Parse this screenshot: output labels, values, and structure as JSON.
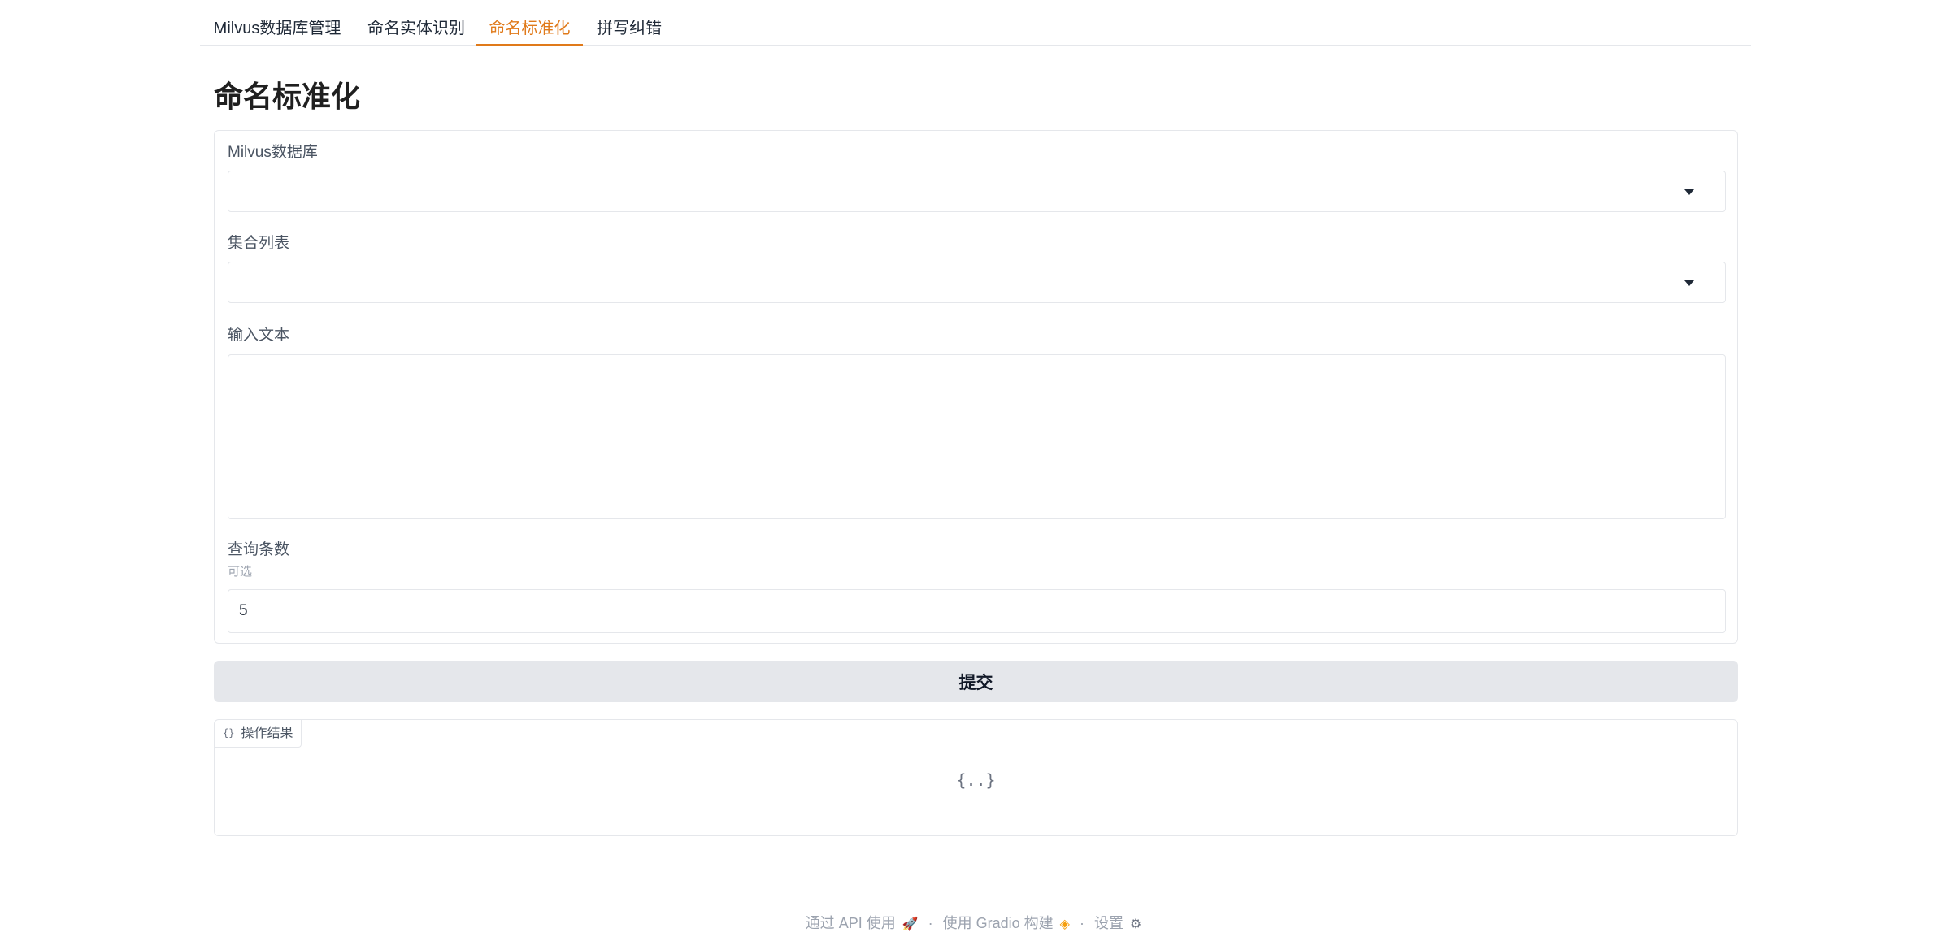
{
  "tabs": [
    {
      "label": "Milvus数据库管理",
      "active": false
    },
    {
      "label": "命名实体识别",
      "active": false
    },
    {
      "label": "命名标准化",
      "active": true
    },
    {
      "label": "拼写纠错",
      "active": false
    }
  ],
  "page_title": "命名标准化",
  "form": {
    "database_label": "Milvus数据库",
    "database_value": "",
    "collection_label": "集合列表",
    "collection_value": "",
    "input_label": "输入文本",
    "input_value": "",
    "count_label": "查询条数",
    "count_info": "可选",
    "count_value": "5"
  },
  "submit_label": "提交",
  "result": {
    "label": "操作结果",
    "icon": "{}",
    "placeholder": "{..}"
  },
  "footer": {
    "api_label": "通过 API 使用",
    "api_icon": "rocket-icon",
    "built_label": "使用 Gradio 构建",
    "built_icon": "gradio-logo-icon",
    "settings_label": "设置",
    "settings_icon": "gear-icon",
    "separator": "·"
  },
  "colors": {
    "accent": "#e07a1a",
    "border": "#e5e7eb",
    "button_bg": "#e5e7eb"
  }
}
